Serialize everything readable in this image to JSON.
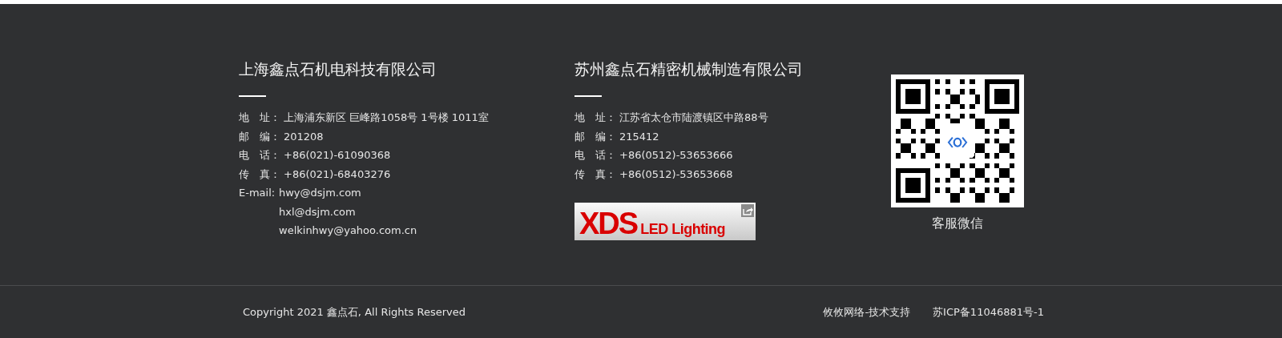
{
  "companies": [
    {
      "name": "上海鑫点石机电科技有限公司",
      "rows": [
        {
          "label": "地　址：",
          "value": "上海浦东新区 巨峰路1058号 1号楼 1011室"
        },
        {
          "label": "邮　编：",
          "value": "201208"
        },
        {
          "label": "电　话：",
          "value": "+86(021)-61090368"
        },
        {
          "label": "传　真：",
          "value": "+86(021)-68403276"
        }
      ],
      "email": {
        "label": "E-mail:",
        "values": [
          "hwy@dsjm.com",
          "hxl@dsjm.com",
          "welkinhwy@yahoo.com.cn"
        ]
      }
    },
    {
      "name": "苏州鑫点石精密机械制造有限公司",
      "rows": [
        {
          "label": "地　址：",
          "value": "江苏省太仓市陆渡镇区中路88号"
        },
        {
          "label": "邮　编：",
          "value": "215412"
        },
        {
          "label": "电　话：",
          "value": "+86(0512)-53653666"
        },
        {
          "label": "传　真：",
          "value": "+86(0512)-53653668"
        }
      ],
      "banner": {
        "brand": "XDS",
        "tagline": "LED Lighting"
      }
    }
  ],
  "qr": {
    "caption": "客服微信"
  },
  "bottom_bar": {
    "copyright": "Copyright 2021 鑫点石, All Rights Reserved",
    "links": [
      "攸攸网络-技术支持",
      "苏ICP备11046881号-1"
    ]
  }
}
